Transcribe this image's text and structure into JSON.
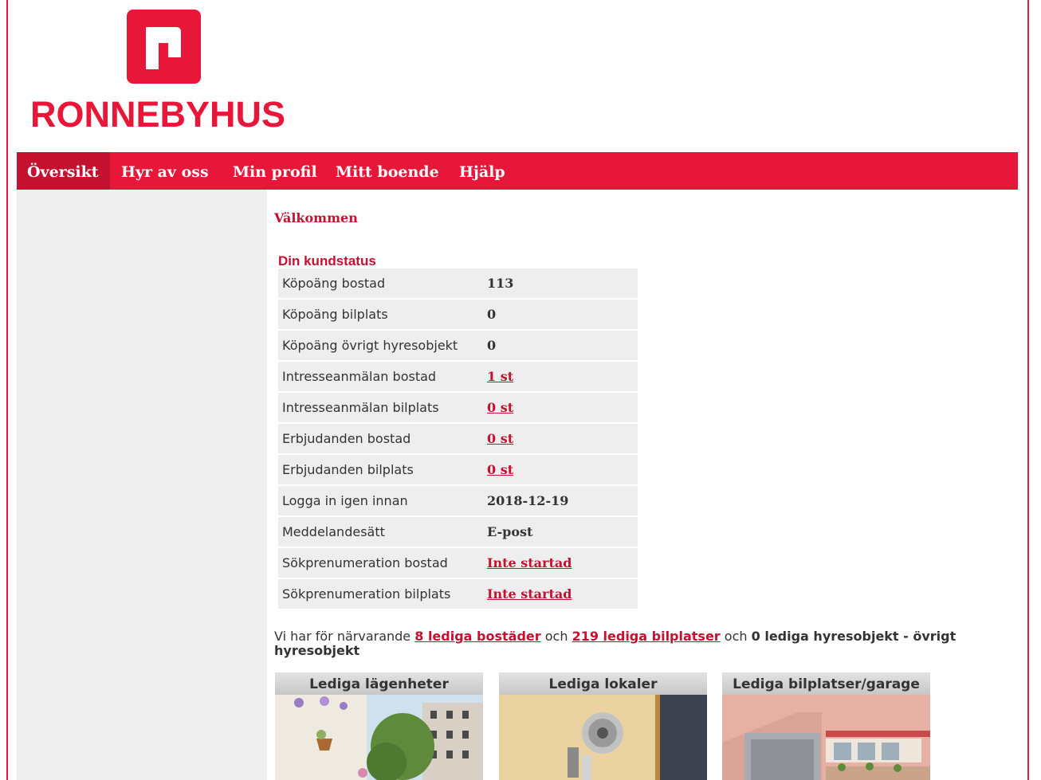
{
  "brand": {
    "name": "RONNEBYHUS",
    "color": "#e8173a"
  },
  "nav": {
    "items": [
      {
        "label": "Översikt",
        "active": true
      },
      {
        "label": "Hyr av oss",
        "active": false
      },
      {
        "label": "Min profil",
        "active": false
      },
      {
        "label": "Mitt boende",
        "active": false
      },
      {
        "label": "Hjälp",
        "active": false
      }
    ]
  },
  "main": {
    "welcome": "Välkommen",
    "status_title": "Din kundstatus",
    "status_rows": [
      {
        "label": "Köpoäng bostad",
        "value": "113",
        "link": false
      },
      {
        "label": "Köpoäng bilplats",
        "value": "0",
        "link": false
      },
      {
        "label": "Köpoäng övrigt hyresobjekt",
        "value": "0",
        "link": false
      },
      {
        "label": "Intresseanmälan bostad",
        "value": "1 st",
        "link": true
      },
      {
        "label": "Intresseanmälan bilplats",
        "value": "0 st",
        "link": true
      },
      {
        "label": "Erbjudanden bostad",
        "value": "0 st",
        "link": true
      },
      {
        "label": "Erbjudanden bilplats",
        "value": "0 st",
        "link": true
      },
      {
        "label": "Logga in igen innan",
        "value": "2018-12-19",
        "link": false
      },
      {
        "label": "Meddelandesätt",
        "value": "E-post",
        "link": false
      },
      {
        "label": "Sökprenumeration bostad",
        "value": "Inte startad",
        "link": true
      },
      {
        "label": "Sökprenumeration bilplats",
        "value": "Inte startad",
        "link": true
      }
    ],
    "summary": {
      "prefix": "Vi har för närvarande",
      "link_bostader": "8 lediga bostäder",
      "och1": "och",
      "link_bilplatser": "219 lediga bilplatser",
      "och2": "och",
      "other_bold": "0 lediga hyresobjekt - övrigt hyresobjekt"
    },
    "cards": [
      {
        "title": "Lediga lägenheter"
      },
      {
        "title": "Lediga lokaler"
      },
      {
        "title": "Lediga bilplatser/garage"
      }
    ]
  }
}
